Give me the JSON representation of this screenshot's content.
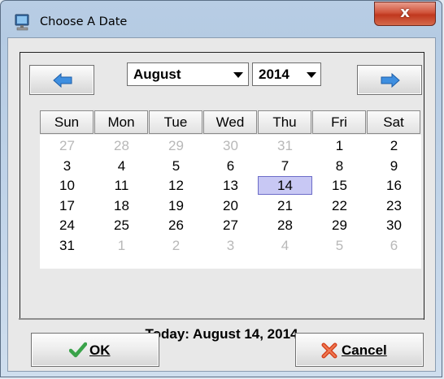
{
  "window": {
    "title": "Choose A Date",
    "close_label": "x"
  },
  "navigation": {
    "prev_icon": "arrow-left-icon",
    "next_icon": "arrow-right-icon",
    "month": "August",
    "year": "2014"
  },
  "calendar": {
    "weekdays": [
      "Sun",
      "Mon",
      "Tue",
      "Wed",
      "Thu",
      "Fri",
      "Sat"
    ],
    "weeks": [
      [
        {
          "d": "27",
          "muted": true
        },
        {
          "d": "28",
          "muted": true
        },
        {
          "d": "29",
          "muted": true
        },
        {
          "d": "30",
          "muted": true
        },
        {
          "d": "31",
          "muted": true
        },
        {
          "d": "1"
        },
        {
          "d": "2"
        }
      ],
      [
        {
          "d": "3"
        },
        {
          "d": "4"
        },
        {
          "d": "5"
        },
        {
          "d": "6"
        },
        {
          "d": "7"
        },
        {
          "d": "8"
        },
        {
          "d": "9"
        }
      ],
      [
        {
          "d": "10"
        },
        {
          "d": "11"
        },
        {
          "d": "12"
        },
        {
          "d": "13"
        },
        {
          "d": "14",
          "selected": true
        },
        {
          "d": "15"
        },
        {
          "d": "16"
        }
      ],
      [
        {
          "d": "17"
        },
        {
          "d": "18"
        },
        {
          "d": "19"
        },
        {
          "d": "20"
        },
        {
          "d": "21"
        },
        {
          "d": "22"
        },
        {
          "d": "23"
        }
      ],
      [
        {
          "d": "24"
        },
        {
          "d": "25"
        },
        {
          "d": "26"
        },
        {
          "d": "27"
        },
        {
          "d": "28"
        },
        {
          "d": "29"
        },
        {
          "d": "30"
        }
      ],
      [
        {
          "d": "31"
        },
        {
          "d": "1",
          "muted": true
        },
        {
          "d": "2",
          "muted": true
        },
        {
          "d": "3",
          "muted": true
        },
        {
          "d": "4",
          "muted": true
        },
        {
          "d": "5",
          "muted": true
        },
        {
          "d": "6",
          "muted": true
        }
      ]
    ],
    "today_text": "Today: August 14, 2014"
  },
  "buttons": {
    "ok": {
      "mnemonic": "O",
      "rest": "K",
      "icon": "checkmark-icon"
    },
    "cancel": {
      "mnemonic": "C",
      "rest": "ancel",
      "icon": "cancel-x-icon"
    }
  },
  "colors": {
    "selected_day_bg": "#c8c8f4",
    "selected_day_border": "#6c6cc8",
    "muted_day": "#b8b8b8",
    "nav_arrow": "#3f8fe0",
    "ok_check": "#3aa34a",
    "cancel_x": "#d5411f"
  }
}
